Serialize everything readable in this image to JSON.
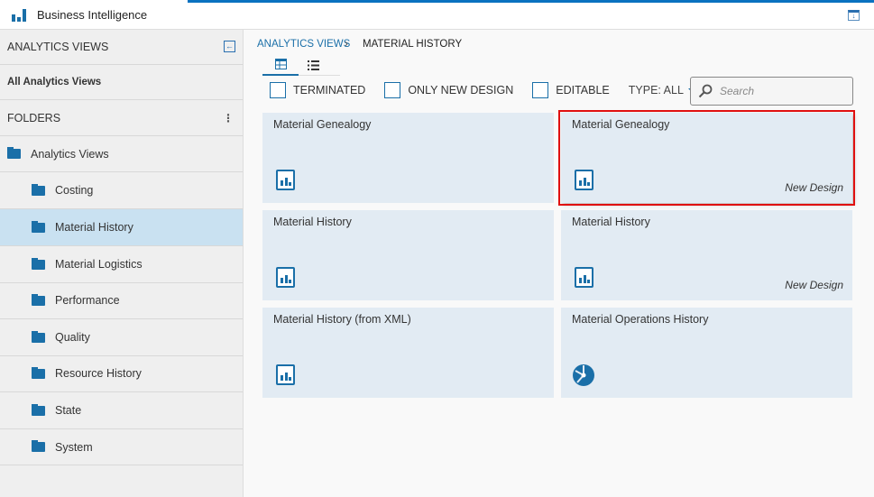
{
  "app": {
    "title": "Business Intelligence"
  },
  "sidebar": {
    "header": "ANALYTICS VIEWS",
    "all_views": "All Analytics Views",
    "folders_label": "FOLDERS",
    "root": "Analytics Views",
    "items": [
      {
        "label": "Costing"
      },
      {
        "label": "Material History",
        "selected": true
      },
      {
        "label": "Material Logistics"
      },
      {
        "label": "Performance"
      },
      {
        "label": "Quality"
      },
      {
        "label": "Resource History"
      },
      {
        "label": "State"
      },
      {
        "label": "System"
      }
    ]
  },
  "breadcrumb": {
    "root": "ANALYTICS VIEWS",
    "current": "MATERIAL HISTORY"
  },
  "filters": {
    "terminated": "TERMINATED",
    "only_new": "ONLY NEW DESIGN",
    "editable": "EDITABLE",
    "type": "TYPE: ALL"
  },
  "search": {
    "placeholder": "Search"
  },
  "cards": [
    {
      "title": "Material Genealogy",
      "tag": "",
      "icon": "report"
    },
    {
      "title": "Material Genealogy",
      "tag": "New Design",
      "icon": "report",
      "highlighted": true
    },
    {
      "title": "Material History",
      "tag": "",
      "icon": "report"
    },
    {
      "title": "Material History",
      "tag": "New Design",
      "icon": "report"
    },
    {
      "title": "Material History (from XML)",
      "tag": "",
      "icon": "report"
    },
    {
      "title": "Material Operations History",
      "tag": "",
      "icon": "pie"
    }
  ],
  "colors": {
    "accent": "#1a6fa8",
    "selected": "#c9e1f1",
    "card": "#e2ebf3",
    "highlight": "#e01010"
  }
}
